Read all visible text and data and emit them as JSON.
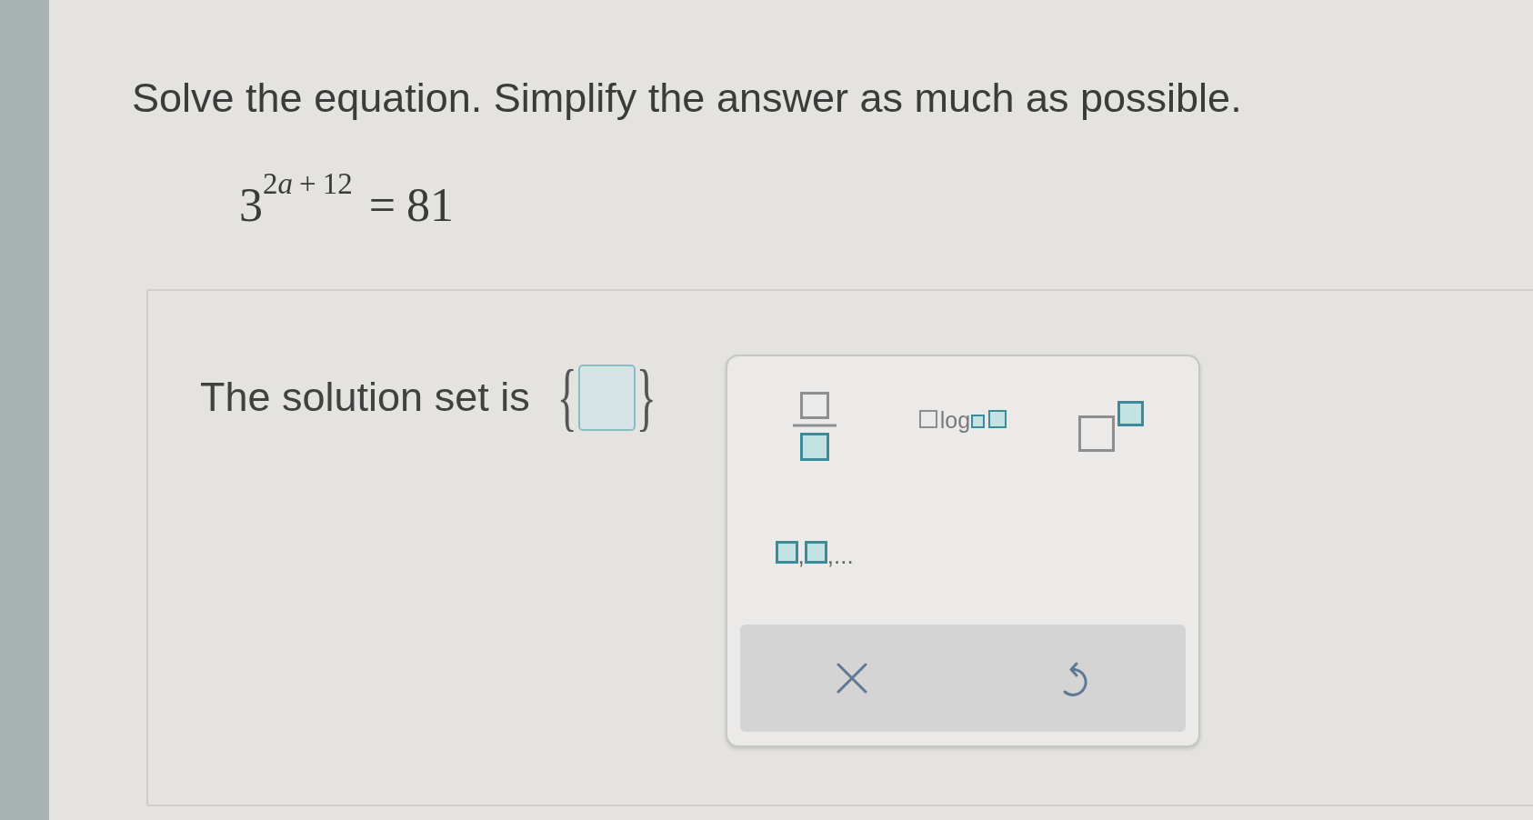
{
  "question": {
    "instruction": "Solve the equation. Simplify the answer as much as possible.",
    "equation": {
      "base": "3",
      "exponent": {
        "coefficient": "2",
        "variable": "a",
        "operator": "+",
        "constant": "12"
      },
      "relation": "=",
      "rhs": "81"
    }
  },
  "answer": {
    "label": "The solution set is",
    "open_brace": "{",
    "close_brace": "}"
  },
  "palette": {
    "templates": [
      {
        "kind": "fraction"
      },
      {
        "kind": "logarithm",
        "label": "log"
      },
      {
        "kind": "power"
      },
      {
        "kind": "list",
        "separators": [
          ",",
          ",..."
        ]
      }
    ],
    "actions": [
      {
        "kind": "clear"
      },
      {
        "kind": "undo"
      }
    ]
  }
}
